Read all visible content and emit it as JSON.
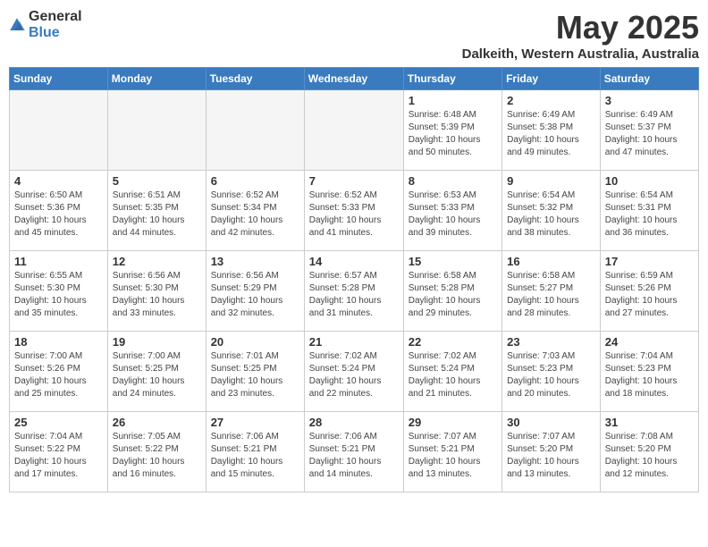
{
  "header": {
    "logo_general": "General",
    "logo_blue": "Blue",
    "month_year": "May 2025",
    "location": "Dalkeith, Western Australia, Australia"
  },
  "weekdays": [
    "Sunday",
    "Monday",
    "Tuesday",
    "Wednesday",
    "Thursday",
    "Friday",
    "Saturday"
  ],
  "weeks": [
    [
      {
        "day": "",
        "info": ""
      },
      {
        "day": "",
        "info": ""
      },
      {
        "day": "",
        "info": ""
      },
      {
        "day": "",
        "info": ""
      },
      {
        "day": "1",
        "info": "Sunrise: 6:48 AM\nSunset: 5:39 PM\nDaylight: 10 hours\nand 50 minutes."
      },
      {
        "day": "2",
        "info": "Sunrise: 6:49 AM\nSunset: 5:38 PM\nDaylight: 10 hours\nand 49 minutes."
      },
      {
        "day": "3",
        "info": "Sunrise: 6:49 AM\nSunset: 5:37 PM\nDaylight: 10 hours\nand 47 minutes."
      }
    ],
    [
      {
        "day": "4",
        "info": "Sunrise: 6:50 AM\nSunset: 5:36 PM\nDaylight: 10 hours\nand 45 minutes."
      },
      {
        "day": "5",
        "info": "Sunrise: 6:51 AM\nSunset: 5:35 PM\nDaylight: 10 hours\nand 44 minutes."
      },
      {
        "day": "6",
        "info": "Sunrise: 6:52 AM\nSunset: 5:34 PM\nDaylight: 10 hours\nand 42 minutes."
      },
      {
        "day": "7",
        "info": "Sunrise: 6:52 AM\nSunset: 5:33 PM\nDaylight: 10 hours\nand 41 minutes."
      },
      {
        "day": "8",
        "info": "Sunrise: 6:53 AM\nSunset: 5:33 PM\nDaylight: 10 hours\nand 39 minutes."
      },
      {
        "day": "9",
        "info": "Sunrise: 6:54 AM\nSunset: 5:32 PM\nDaylight: 10 hours\nand 38 minutes."
      },
      {
        "day": "10",
        "info": "Sunrise: 6:54 AM\nSunset: 5:31 PM\nDaylight: 10 hours\nand 36 minutes."
      }
    ],
    [
      {
        "day": "11",
        "info": "Sunrise: 6:55 AM\nSunset: 5:30 PM\nDaylight: 10 hours\nand 35 minutes."
      },
      {
        "day": "12",
        "info": "Sunrise: 6:56 AM\nSunset: 5:30 PM\nDaylight: 10 hours\nand 33 minutes."
      },
      {
        "day": "13",
        "info": "Sunrise: 6:56 AM\nSunset: 5:29 PM\nDaylight: 10 hours\nand 32 minutes."
      },
      {
        "day": "14",
        "info": "Sunrise: 6:57 AM\nSunset: 5:28 PM\nDaylight: 10 hours\nand 31 minutes."
      },
      {
        "day": "15",
        "info": "Sunrise: 6:58 AM\nSunset: 5:28 PM\nDaylight: 10 hours\nand 29 minutes."
      },
      {
        "day": "16",
        "info": "Sunrise: 6:58 AM\nSunset: 5:27 PM\nDaylight: 10 hours\nand 28 minutes."
      },
      {
        "day": "17",
        "info": "Sunrise: 6:59 AM\nSunset: 5:26 PM\nDaylight: 10 hours\nand 27 minutes."
      }
    ],
    [
      {
        "day": "18",
        "info": "Sunrise: 7:00 AM\nSunset: 5:26 PM\nDaylight: 10 hours\nand 25 minutes."
      },
      {
        "day": "19",
        "info": "Sunrise: 7:00 AM\nSunset: 5:25 PM\nDaylight: 10 hours\nand 24 minutes."
      },
      {
        "day": "20",
        "info": "Sunrise: 7:01 AM\nSunset: 5:25 PM\nDaylight: 10 hours\nand 23 minutes."
      },
      {
        "day": "21",
        "info": "Sunrise: 7:02 AM\nSunset: 5:24 PM\nDaylight: 10 hours\nand 22 minutes."
      },
      {
        "day": "22",
        "info": "Sunrise: 7:02 AM\nSunset: 5:24 PM\nDaylight: 10 hours\nand 21 minutes."
      },
      {
        "day": "23",
        "info": "Sunrise: 7:03 AM\nSunset: 5:23 PM\nDaylight: 10 hours\nand 20 minutes."
      },
      {
        "day": "24",
        "info": "Sunrise: 7:04 AM\nSunset: 5:23 PM\nDaylight: 10 hours\nand 18 minutes."
      }
    ],
    [
      {
        "day": "25",
        "info": "Sunrise: 7:04 AM\nSunset: 5:22 PM\nDaylight: 10 hours\nand 17 minutes."
      },
      {
        "day": "26",
        "info": "Sunrise: 7:05 AM\nSunset: 5:22 PM\nDaylight: 10 hours\nand 16 minutes."
      },
      {
        "day": "27",
        "info": "Sunrise: 7:06 AM\nSunset: 5:21 PM\nDaylight: 10 hours\nand 15 minutes."
      },
      {
        "day": "28",
        "info": "Sunrise: 7:06 AM\nSunset: 5:21 PM\nDaylight: 10 hours\nand 14 minutes."
      },
      {
        "day": "29",
        "info": "Sunrise: 7:07 AM\nSunset: 5:21 PM\nDaylight: 10 hours\nand 13 minutes."
      },
      {
        "day": "30",
        "info": "Sunrise: 7:07 AM\nSunset: 5:20 PM\nDaylight: 10 hours\nand 13 minutes."
      },
      {
        "day": "31",
        "info": "Sunrise: 7:08 AM\nSunset: 5:20 PM\nDaylight: 10 hours\nand 12 minutes."
      }
    ]
  ]
}
